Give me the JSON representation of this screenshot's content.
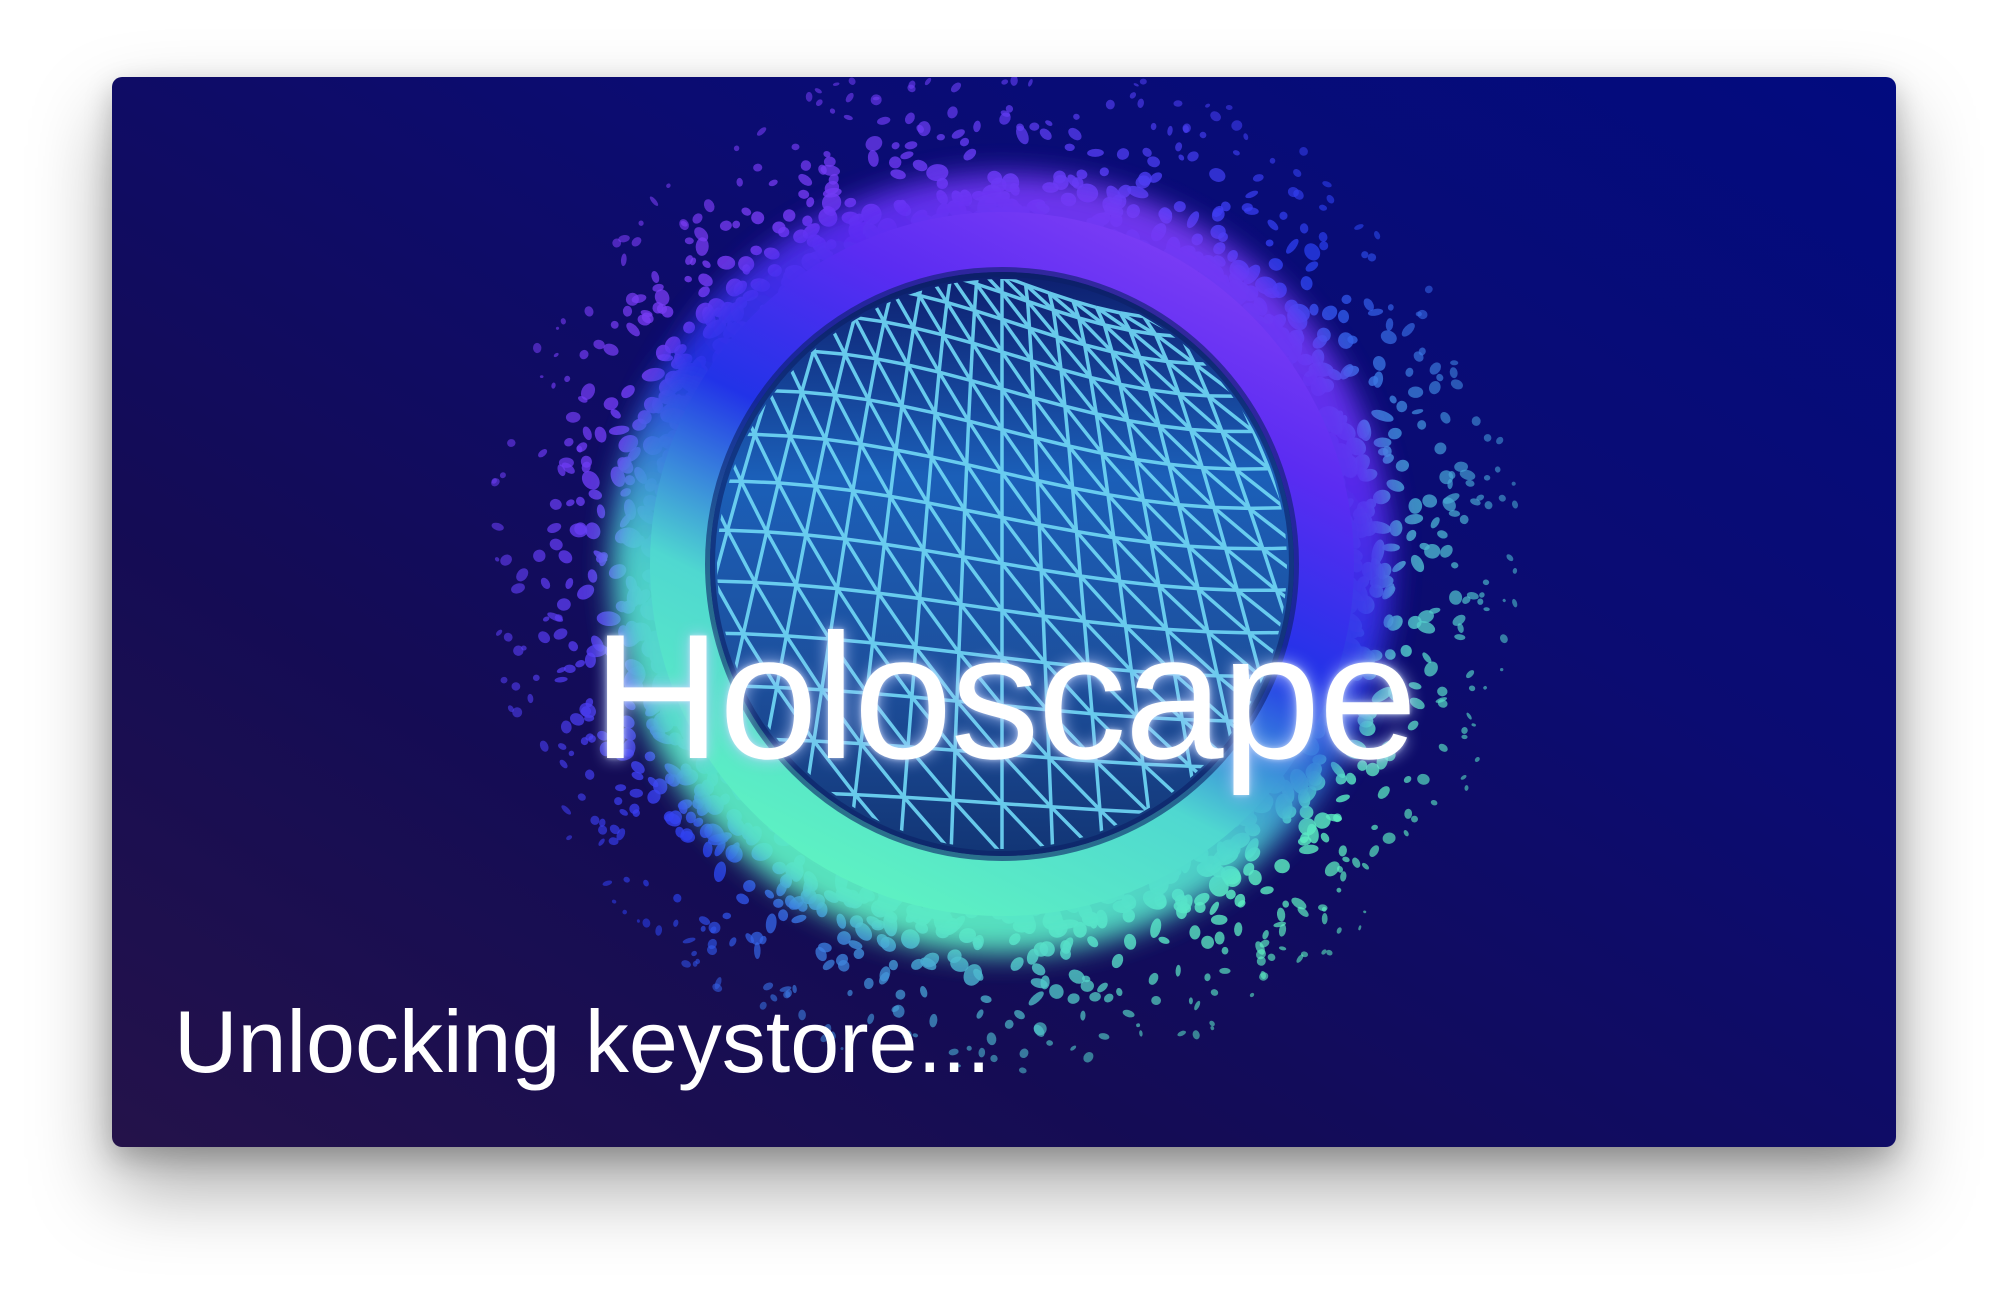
{
  "splash": {
    "app_name": "Holoscape",
    "status": "Unlocking keystore..."
  },
  "colors": {
    "background_dark": "#140c55",
    "background_blue": "#020b7f",
    "ring_purple": "#6a2ff0",
    "ring_blue": "#2233e8",
    "ring_mint": "#5ef2c2",
    "grid_cyan": "#6fd6f5",
    "text": "#ffffff"
  },
  "icons": {
    "logo": "holoscape-orb-logo"
  }
}
